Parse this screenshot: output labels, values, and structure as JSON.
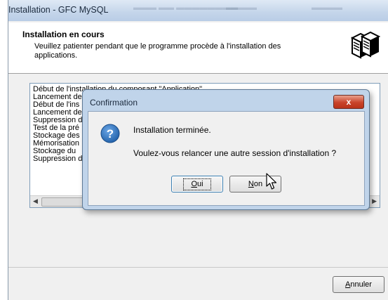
{
  "window": {
    "title": "Installation - GFC MySQL",
    "header_title": "Installation en cours",
    "header_subtitle": "Veuillez patienter pendant que le programme procède à l'installation des applications."
  },
  "log": {
    "lines": [
      "Début de l'installation du composant \"Application\"",
      "Lancement de",
      "Début de l'ins",
      "Lancement de",
      "Suppression d",
      "Test de la pré",
      "Stockage des",
      "Mémorisation",
      "Stockage du",
      "Suppression d"
    ]
  },
  "cancel_button": {
    "mnemonic": "A",
    "rest": "nnuler"
  },
  "dialog": {
    "title": "Confirmation",
    "close_glyph": "x",
    "message_line1": "Installation terminée.",
    "message_line2": "Voulez-vous relancer une autre session d'installation ?",
    "yes_button": {
      "mnemonic": "O",
      "rest": "ui"
    },
    "no_button": {
      "mnemonic": "N",
      "rest": "on"
    }
  },
  "colors": {
    "accent": "#1f5fa8",
    "close_red": "#c9432a",
    "dialog_frame": "#c0d4ea"
  }
}
